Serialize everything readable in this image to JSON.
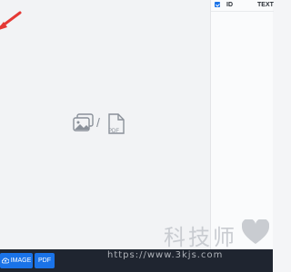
{
  "canvas": {
    "drop_separator": "/",
    "pdf_icon_label": "PDF"
  },
  "panel": {
    "columns": [
      "ID",
      "TEXT"
    ]
  },
  "toolbar": {
    "image_button_label": "IMAGE",
    "pdf_button_label": "PDF"
  },
  "watermark": {
    "brand": "科技师",
    "url": "https://www.3kjs.com"
  },
  "colors": {
    "accent": "#1a73e8",
    "arrow": "#e53935",
    "bottom_bar": "#1f2530"
  }
}
